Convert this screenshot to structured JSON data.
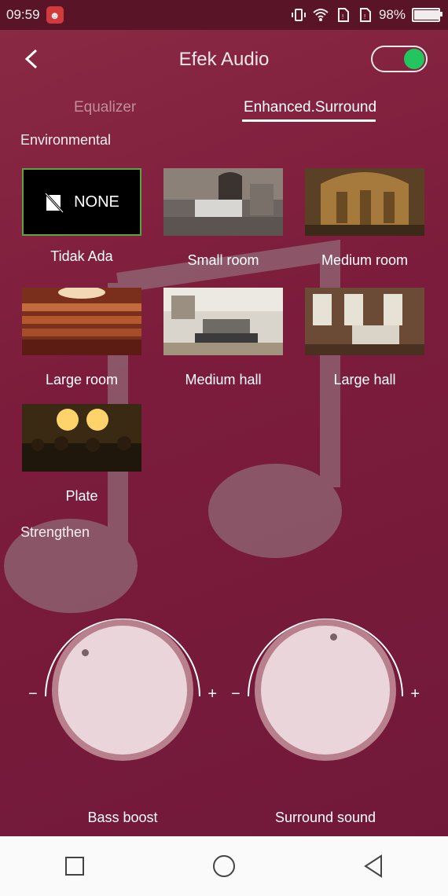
{
  "status": {
    "time": "09:59",
    "battery": "98%",
    "battery_level": 0.98
  },
  "topbar": {
    "title": "Efek Audio",
    "toggle_on": true
  },
  "tabs": [
    {
      "label": "Equalizer",
      "active": false
    },
    {
      "label": "Enhanced.Surround",
      "active": true
    }
  ],
  "environmental": {
    "title": "Environmental",
    "presets": [
      {
        "label": "Tidak Ada",
        "thumb_text": "NONE",
        "selected": true
      },
      {
        "label": "Small room",
        "selected": false
      },
      {
        "label": "Medium room",
        "selected": false
      },
      {
        "label": "Large room",
        "selected": false
      },
      {
        "label": "Medium hall",
        "selected": false
      },
      {
        "label": "Large hall",
        "selected": false
      },
      {
        "label": "Plate",
        "selected": false
      }
    ]
  },
  "strengthen": {
    "title": "Strengthen",
    "controls": [
      {
        "label": "Bass boost",
        "minus": "−",
        "plus": "+"
      },
      {
        "label": "Surround sound",
        "minus": "−",
        "plus": "+"
      }
    ]
  },
  "colors": {
    "accent_toggle": "#22c55e",
    "selected_border": "#5aa33d",
    "background": "#7c1c3c"
  }
}
